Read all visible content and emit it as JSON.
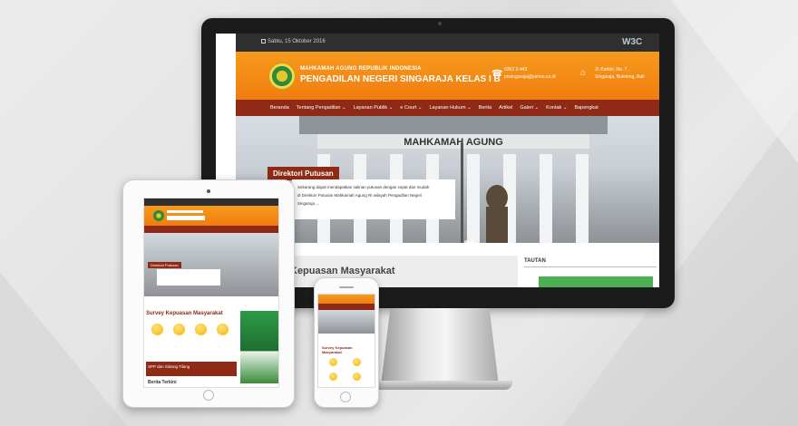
{
  "desktop": {
    "topbar_date": "Sabtu, 15 Oktober 2016",
    "w3c_badge": "W3C",
    "org_line1": "MAHKAMAH AGUNG REPUBLIK INDONESIA",
    "org_line2": "PENGADILAN NEGERI SINGARAJA KELAS I B",
    "phone": "0362 2-443",
    "email": "pnsingaraja@yahoo.co.id",
    "address1": "Jl. Kartini, No. 7",
    "address2": "Singaraja, Buleleng, Bali",
    "nav": [
      "Beranda",
      "Tentang Pengadilan ⌄",
      "Layanan Publik ⌄",
      "e Court ⌄",
      "Layanan Hukum ⌄",
      "Berita",
      "Artikel",
      "Galeri ⌄",
      "Kontak ⌄",
      "Bapengkat"
    ],
    "hero_building_text": "MAHKAMAH AGUNG",
    "direktori_title": "Direktori Putusan",
    "direktori_text1": "Sekarang dapat mendapatkan salinan putusan dengan cepat dan mudah",
    "direktori_text2": "di Direktori Putusan Mahkamah Agung RI wilayah Pengadilan Negeri",
    "direktori_text3": "Singaraja ...",
    "survey_title": "Kepuasan Masyarakat",
    "tautan_title": "TAUTAN"
  },
  "tablet": {
    "direktori_title": "Direktori Putusan",
    "survey_title": "Survey Kepuasan Masyarakat",
    "spp_title": "SPP dan Sidang Tilang",
    "berita_title": "Berita Terkini"
  },
  "phone": {
    "survey_title": "Survey Kepuasan Masyarakat"
  },
  "colors": {
    "brand_orange": "#f07d10",
    "brand_maroon": "#8e2a15",
    "topbar": "#2f2f2f"
  }
}
